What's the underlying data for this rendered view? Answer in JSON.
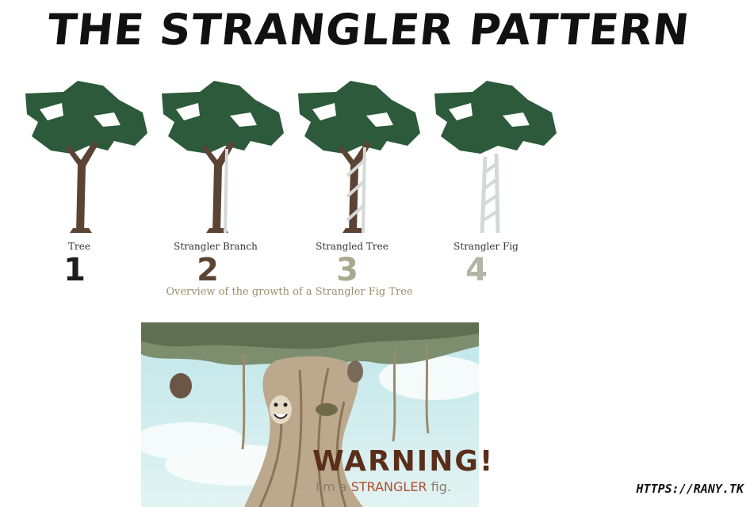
{
  "title": "THE STRANGLER PATTERN",
  "stages": [
    {
      "label": "Tree",
      "number": "1",
      "color": "#1e1e1e"
    },
    {
      "label": "Strangler Branch",
      "number": "2",
      "color": "#5a4434"
    },
    {
      "label": "Strangled Tree",
      "number": "3",
      "color": "#a9a98e"
    },
    {
      "label": "Strangler Fig",
      "number": "4",
      "color": "#b5b5a5"
    }
  ],
  "caption": "Overview of the growth of a Strangler Fig Tree",
  "warning": {
    "title": "WARNING!",
    "subtitle_prefix": "I'm a ",
    "subtitle_highlight": "STRANGLER",
    "subtitle_suffix": " fig."
  },
  "url": "HTTPS://RANY.TK",
  "colors": {
    "canopy": "#2c5a3a",
    "trunk": "#5b4434",
    "fig_vine": "#d4d8d6",
    "warning_brown": "#5a2e1a",
    "caption": "#9a8f6c"
  }
}
